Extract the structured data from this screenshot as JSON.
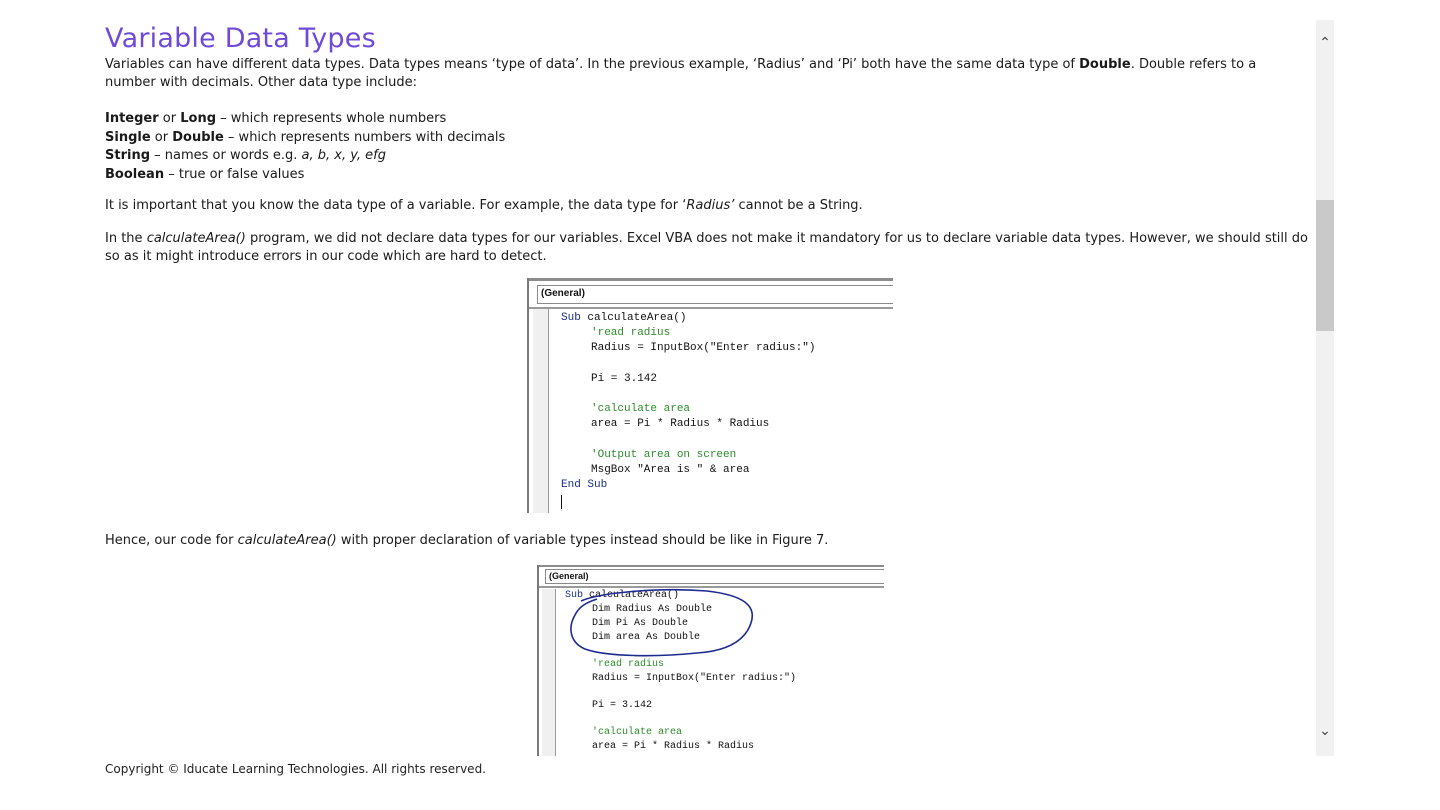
{
  "doc": {
    "title": "Variable Data Types",
    "intro": {
      "s1": "Variables can have different data types. Data types means ‘type of data’. In the previous example, ‘Radius’ and ‘Pi’ both have the same data type of ",
      "s1_bold": "Double",
      "s2": ". Double refers to a number with decimals. Other data type include:"
    },
    "types": [
      {
        "a": "Integer",
        "or": " or ",
        "b": "Long",
        "desc": " – which represents whole numbers"
      },
      {
        "a": "Single",
        "or": " or ",
        "b": "Double",
        "desc": " – which represents numbers with decimals"
      }
    ],
    "string_type": {
      "name": "String",
      "desc": " – names or words e.g. ",
      "examples": "a, b, x, y, efg"
    },
    "bool_type": {
      "name": "Boolean",
      "desc": " – true or false values"
    },
    "para_important": {
      "s1": "It is important that you know the data type of a variable. For example, the data type for ‘",
      "it": "Radius’",
      "s2": " cannot be a String."
    },
    "para_declare": {
      "s1": "In the ",
      "it": "calculateArea()",
      "s2": " program, we did not declare data types for our variables. Excel VBA does not make it mandatory for us to declare variable data types. However, we should still do so as it might introduce errors in our code which are hard to detect."
    },
    "para_hence": {
      "s1": "Hence, our code for ",
      "it": "calculateArea()",
      "s2": " with proper declaration of variable types instead should be like in Figure 7."
    }
  },
  "code1": {
    "header": "(General)",
    "lines": {
      "l1a": "Sub",
      "l1b": " calculateArea()",
      "l2": "'read radius",
      "l3": "Radius = InputBox(\"Enter radius:\")",
      "l4": "Pi = 3.142",
      "l5": "'calculate area",
      "l6": "area = Pi * Radius * Radius",
      "l7": "'Output area on screen",
      "l8": "MsgBox \"Area is \" & area",
      "l9a": "End",
      "l9b": " ",
      "l9c": "Sub"
    }
  },
  "code2": {
    "header": "(General)",
    "lines": {
      "l1a": "Sub",
      "l1b": " calculateArea()",
      "d1": "Dim Radius As Double",
      "d2": "Dim Pi As Double",
      "d3": "Dim area As Double",
      "l2": "'read radius",
      "l3": "Radius = InputBox(\"Enter radius:\")",
      "l4": "Pi = 3.142",
      "l5": "'calculate area",
      "l6": "area = Pi * Radius * Radius"
    }
  },
  "footer": "Copyright © Iducate Learning Technologies. All rights reserved.",
  "icons": {
    "scroll_up": "chevron-up-icon",
    "scroll_down": "chevron-down-icon"
  },
  "colors": {
    "title": "#6f4ad8",
    "code_keyword": "#1a2f8a",
    "code_comment": "#2e8b2e",
    "annotation_ink": "#1d2a8f"
  }
}
